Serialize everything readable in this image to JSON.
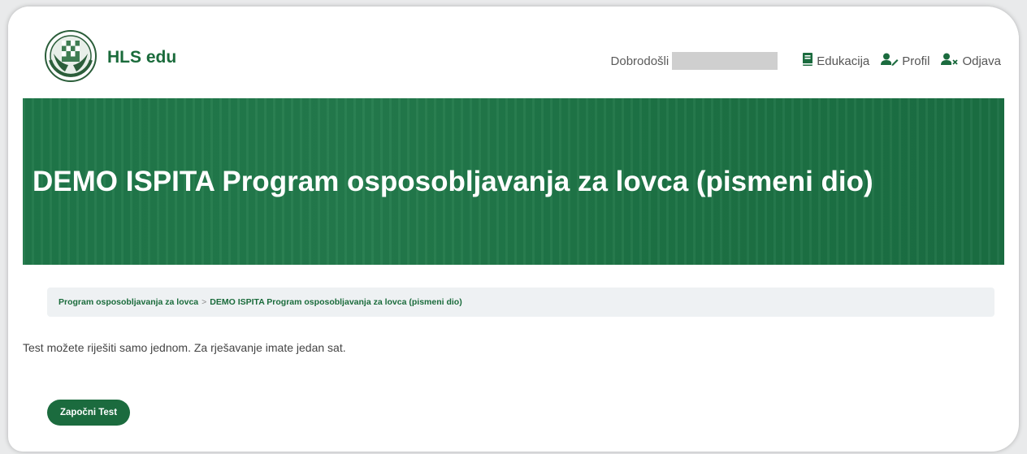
{
  "header": {
    "brand": "HLS edu",
    "welcome": "Dobrodošli",
    "nav": {
      "education": "Edukacija",
      "profile": "Profil",
      "logout": "Odjava"
    }
  },
  "hero": {
    "title": "DEMO ISPITA Program osposobljavanja za lovca (pismeni dio)"
  },
  "breadcrumb": {
    "parent": "Program osposobljavanja za lovca",
    "separator": ">",
    "current": "DEMO ISPITA Program osposobljavanja za lovca (pismeni dio)"
  },
  "content": {
    "info": "Test možete riješiti samo jednom. Za rješavanje imate jedan sat."
  },
  "actions": {
    "start_label": "Započni Test"
  },
  "colors": {
    "brand_green": "#1a6b3b",
    "hero_green": "#1f7749",
    "button_green": "#1b6b3e"
  },
  "icons": {
    "logo": "hunting-association-emblem",
    "education": "book-icon",
    "profile": "user-edit-icon",
    "logout": "user-remove-icon"
  }
}
